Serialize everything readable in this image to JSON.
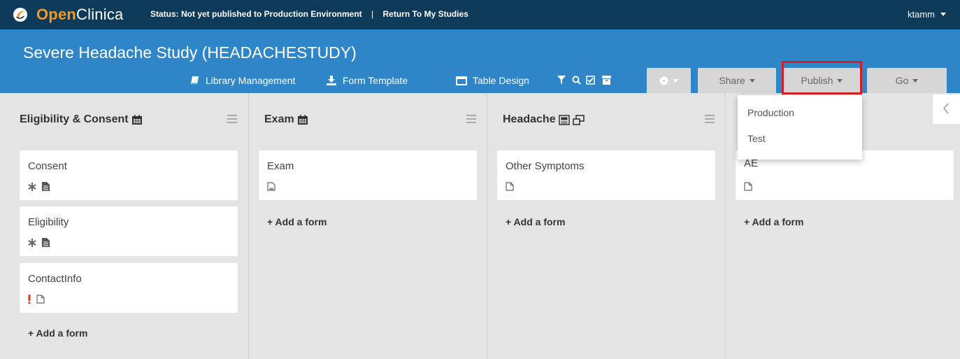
{
  "topbar": {
    "brand_open": "Open",
    "brand_clinica": "Clinica",
    "status": "Status: Not yet published to Production Environment",
    "separator": "|",
    "return_link": "Return To My Studies",
    "user": "ktamm"
  },
  "study": {
    "title": "Severe Headache Study (HEADACHESTUDY)"
  },
  "toolbar": {
    "library": "Library Management",
    "form_template": "Form Template",
    "table_design": "Table Design",
    "share": "Share",
    "publish": "Publish",
    "go": "Go",
    "icons": [
      "book-icon",
      "download-icon",
      "table-icon",
      "filter-icon",
      "search-icon",
      "checkbox-icon",
      "archive-icon",
      "gear-icon"
    ]
  },
  "publish_menu": {
    "items": [
      "Production",
      "Test"
    ]
  },
  "columns": [
    {
      "title": "Eligibility & Consent",
      "icons": [
        "calendar-icon"
      ],
      "forms": [
        {
          "name": "Consent",
          "icons": [
            "asterisk-icon",
            "document-filled-icon"
          ]
        },
        {
          "name": "Eligibility",
          "icons": [
            "asterisk-icon",
            "document-filled-icon"
          ]
        },
        {
          "name": "ContactInfo",
          "icons": [
            "exclamation-icon",
            "document-outline-icon"
          ]
        }
      ],
      "add_label": "+ Add a form"
    },
    {
      "title": "Exam",
      "icons": [
        "calendar-icon"
      ],
      "forms": [
        {
          "name": "Exam",
          "icons": [
            "document-image-icon"
          ]
        }
      ],
      "add_label": "+ Add a form"
    },
    {
      "title": "Headache",
      "icons": [
        "event-icon",
        "repeat-icon"
      ],
      "forms": [
        {
          "name": "Other Symptoms",
          "icons": [
            "document-outline-icon"
          ]
        }
      ],
      "add_label": "+ Add a form"
    },
    {
      "title": "",
      "icons": [],
      "forms": [
        {
          "name": "AE",
          "icons": [
            "document-outline-icon"
          ]
        }
      ],
      "add_label": "+ Add a form"
    }
  ],
  "colors": {
    "topbar_bg": "#0e3a5a",
    "brand_orange": "#f29a1f",
    "studybar_bg": "#2e86c9",
    "board_bg": "#e4e4e4",
    "highlight": "#d21f26",
    "warning": "#d9341f"
  }
}
